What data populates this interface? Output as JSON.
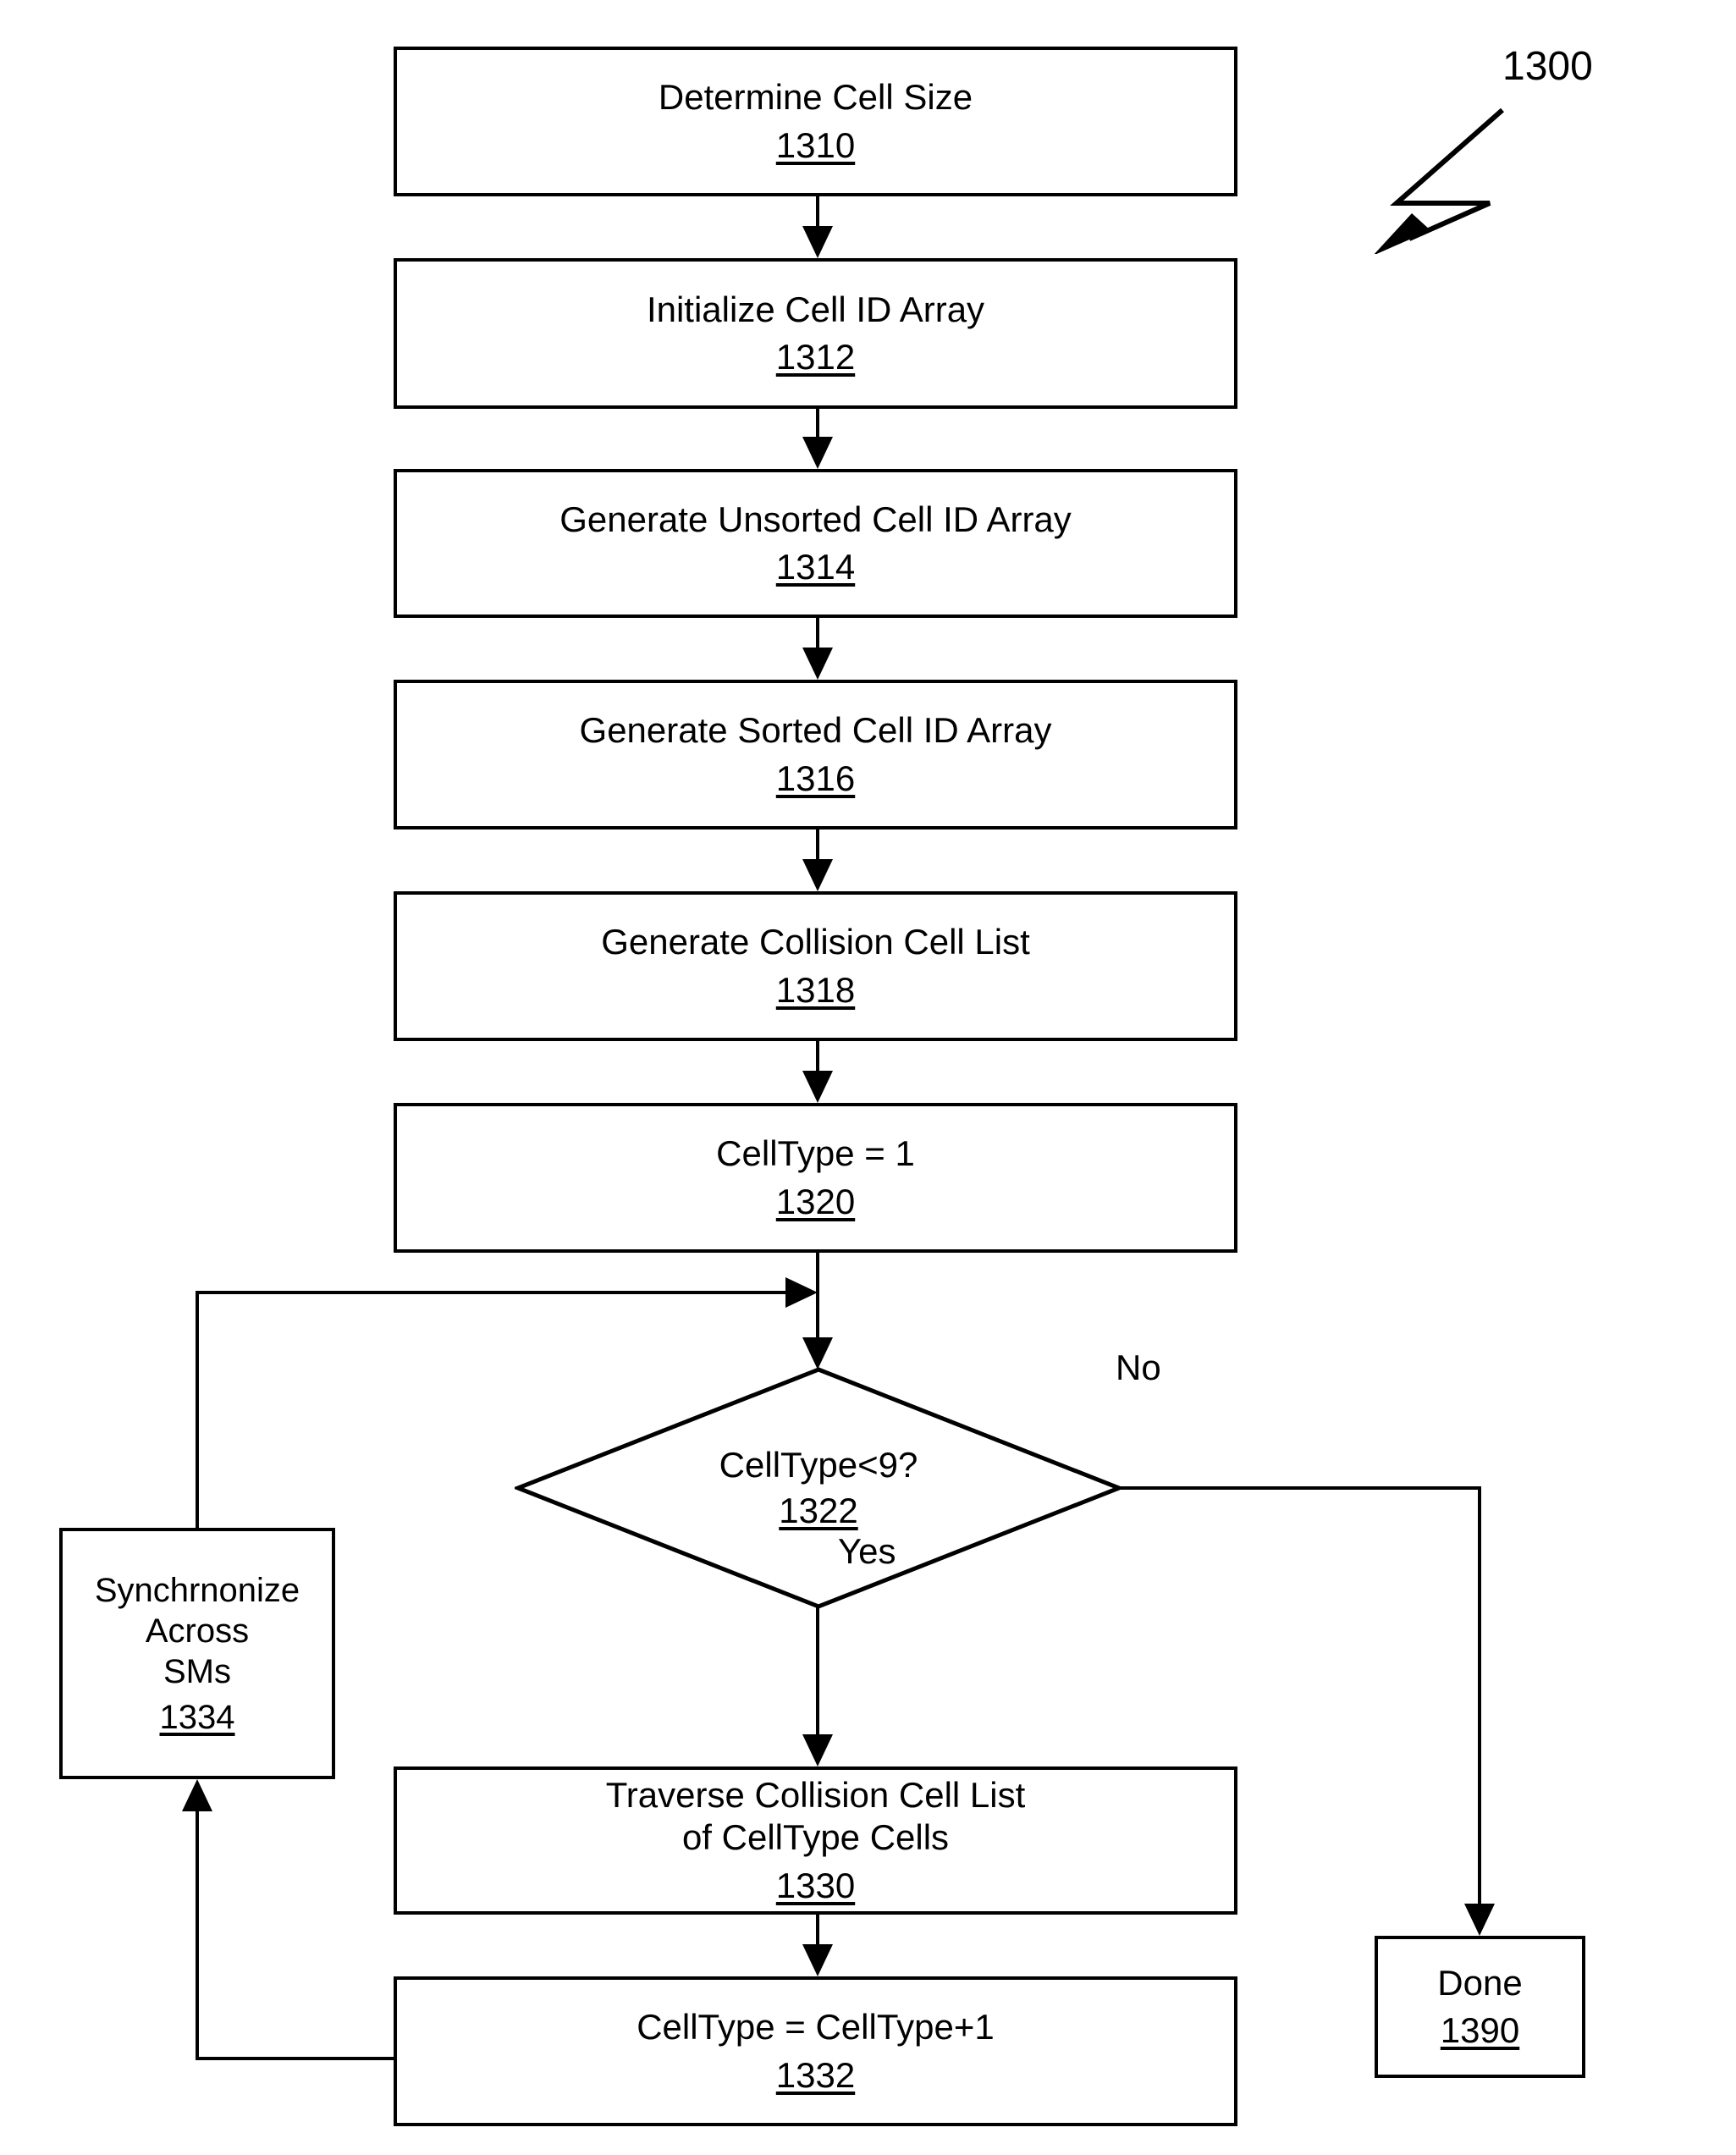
{
  "figure": {
    "reference_numeral": "1300"
  },
  "nodes": [
    {
      "id": "n1310",
      "label": "Determine Cell Size",
      "ref": "1310",
      "shape": "process"
    },
    {
      "id": "n1312",
      "label": "Initialize Cell ID Array",
      "ref": "1312",
      "shape": "process"
    },
    {
      "id": "n1314",
      "label": "Generate Unsorted Cell ID Array",
      "ref": "1314",
      "shape": "process"
    },
    {
      "id": "n1316",
      "label": "Generate Sorted Cell ID Array",
      "ref": "1316",
      "shape": "process"
    },
    {
      "id": "n1318",
      "label": "Generate Collision Cell List",
      "ref": "1318",
      "shape": "process"
    },
    {
      "id": "n1320",
      "label": "CellType = 1",
      "ref": "1320",
      "shape": "process"
    },
    {
      "id": "n1322",
      "label": "CellType<9?",
      "ref": "1322",
      "shape": "decision"
    },
    {
      "id": "n1330",
      "label": "Traverse Collision Cell List\nof CellType Cells",
      "ref": "1330",
      "shape": "process"
    },
    {
      "id": "n1332",
      "label": "CellType = CellType+1",
      "ref": "1332",
      "shape": "process"
    },
    {
      "id": "n1334",
      "label": "Synchrnonize\nAcross\nSMs",
      "ref": "1334",
      "shape": "process"
    },
    {
      "id": "n1390",
      "label": "Done",
      "ref": "1390",
      "shape": "terminator"
    }
  ],
  "edge_labels": {
    "decision_no": "No",
    "decision_yes": "Yes"
  },
  "colors": {
    "stroke": "#000000",
    "background": "#ffffff"
  }
}
